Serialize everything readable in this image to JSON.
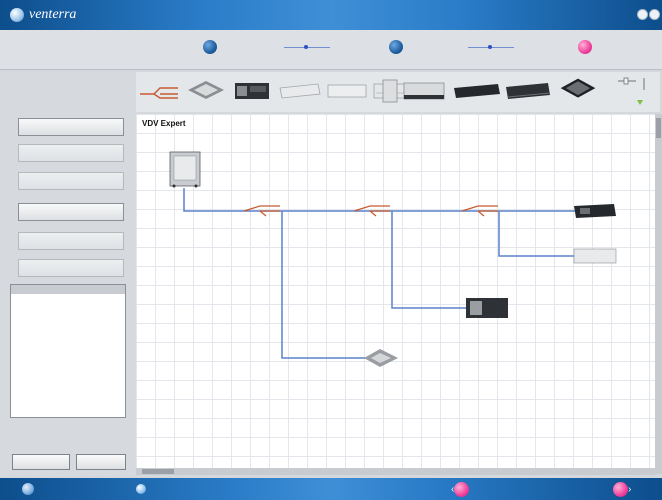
{
  "window": {
    "app_name": "venterra",
    "title": ""
  },
  "stepper": {
    "steps": [
      {
        "label": "",
        "color": "#1f5fa0"
      },
      {
        "label": "",
        "color": "#1f5fa0"
      },
      {
        "label": "",
        "color": "#f0409a"
      }
    ]
  },
  "palette": {
    "items": [
      "refnet-pipe-icon",
      "cassette-icon",
      "ducted-unit-icon",
      "wall-unit-icon",
      "wall-unit-icon",
      "floor-unit-icon",
      "slim-duct-icon",
      "duct-unit-icon",
      "cassette-icon"
    ]
  },
  "sidebar": {
    "buttons": [
      {
        "label": "",
        "enabled": true
      },
      {
        "label": "",
        "enabled": false
      },
      {
        "label": "",
        "enabled": false
      },
      {
        "label": "",
        "enabled": true
      },
      {
        "label": "",
        "enabled": false
      },
      {
        "label": "",
        "enabled": false
      }
    ],
    "list": {
      "header": "",
      "items": [
        ""
      ]
    },
    "info": {
      "line1": "",
      "line2": ""
    },
    "calc_button": "",
    "details_button": ""
  },
  "canvas": {
    "title": "VDV Expert",
    "outdoor_unit": {
      "label": ""
    },
    "joints": [
      {
        "label": ""
      },
      {
        "label": ""
      },
      {
        "label": ""
      }
    ],
    "indoor_units": [
      {
        "name": "",
        "id": ""
      },
      {
        "name": "",
        "id": ""
      },
      {
        "name": "",
        "id": ""
      },
      {
        "name": "",
        "id": ""
      }
    ]
  },
  "bottombar": {
    "menu": "",
    "help": "",
    "back": "",
    "next": ""
  },
  "colors": {
    "pipe": "#5a82c8",
    "accent": "#f0409a",
    "titlebar": "#2a7cc8"
  }
}
